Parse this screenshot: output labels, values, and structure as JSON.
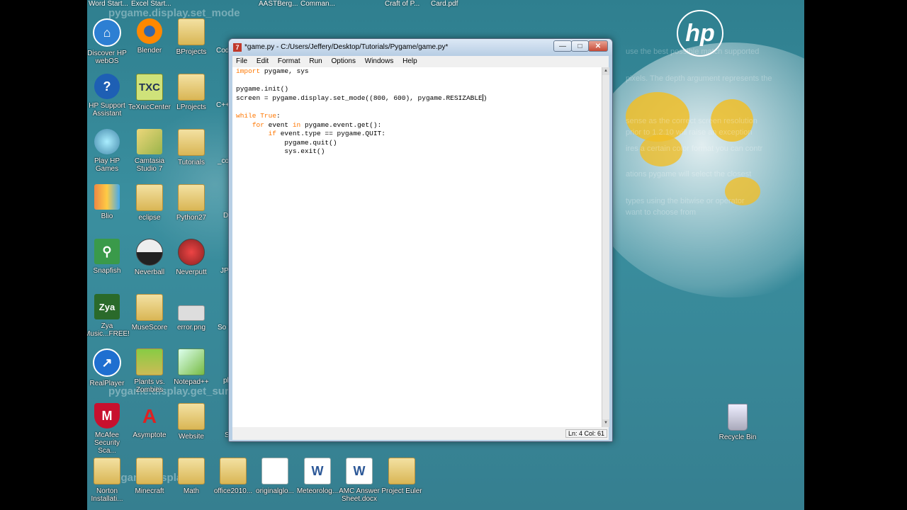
{
  "top_labels": [
    "Word Start...",
    "Excel Start...",
    "AASTBerg...",
    "Comman...",
    "Craft of P...",
    "Card.pdf"
  ],
  "background_ghosts": {
    "heading_1": "pygame.display.set_mode",
    "heading_2": "pygame.display.get_surface",
    "heading_3": "pygame.display.",
    "text_1": "use the best possible match supported",
    "text_2": "pixels. The depth argument represents the",
    "text_3": "sense as the correct screen resolution",
    "text_4": "prior to 1.2.10 will raise an exception",
    "text_5": "ires a certain color format you can contr",
    "text_6": "ations pygame will select the closest",
    "text_7": "types using the bitwise or operator",
    "text_8": "want to choose from"
  },
  "icons": [
    {
      "label": "Discover HP webOS",
      "kind": "hp"
    },
    {
      "label": "Blender",
      "kind": "blender"
    },
    {
      "label": "BProjects",
      "kind": "folder"
    },
    {
      "label": "HP Support Assistant",
      "kind": "help"
    },
    {
      "label": "TeXnicCenter",
      "kind": "txc"
    },
    {
      "label": "LProjects",
      "kind": "folder"
    },
    {
      "label": "Play HP Games",
      "kind": "games"
    },
    {
      "label": "Camtasia Studio 7",
      "kind": "camtasia"
    },
    {
      "label": "Tutorials",
      "kind": "folder"
    },
    {
      "label": "Blio",
      "kind": "blio"
    },
    {
      "label": "eclipse",
      "kind": "folder"
    },
    {
      "label": "Python27",
      "kind": "folder"
    },
    {
      "label": "Snapfish",
      "kind": "snapfish"
    },
    {
      "label": "Neverball",
      "kind": "neverball"
    },
    {
      "label": "Neverputt",
      "kind": "neverputt"
    },
    {
      "label": "Zya Music...FREE!",
      "kind": "zya"
    },
    {
      "label": "MuseScore",
      "kind": "folder"
    },
    {
      "label": "error.png",
      "kind": "image"
    },
    {
      "label": "RealPlayer",
      "kind": "realplayer"
    },
    {
      "label": "Plants vs. Zombies",
      "kind": "pvz"
    },
    {
      "label": "Notepad++",
      "kind": "notepad"
    },
    {
      "label": "McAfee Security Sca...",
      "kind": "mcafee"
    },
    {
      "label": "Asymptote",
      "kind": "asymptote"
    },
    {
      "label": "Website",
      "kind": "folder"
    },
    {
      "label": "Norton Installati...",
      "kind": "folder"
    },
    {
      "label": "Minecraft",
      "kind": "folder"
    },
    {
      "label": "Math",
      "kind": "folder"
    },
    {
      "label": "office2010...",
      "kind": "folder"
    },
    {
      "label": "originalglo...",
      "kind": "doc"
    },
    {
      "label": "Meteorolog...",
      "kind": "word"
    },
    {
      "label": "AMC Answer Sheet.docx",
      "kind": "word"
    },
    {
      "label": "Project Euler",
      "kind": "folder"
    },
    {
      "label": "Recycle Bin",
      "kind": "recycle"
    }
  ],
  "partial_labels": [
    "Cod",
    "C++",
    "_co",
    "D",
    "JP",
    "So Cor",
    "pl",
    "S"
  ],
  "brand": {
    "logo_text": "hp"
  },
  "window": {
    "title": "*game.py - C:/Users/Jeffery/Desktop/Tutorials/Pygame/game.py*",
    "min_symbol": "—",
    "max_symbol": "□",
    "close_symbol": "✕",
    "menu": [
      "File",
      "Edit",
      "Format",
      "Run",
      "Options",
      "Windows",
      "Help"
    ],
    "code": {
      "l1_kw": "import",
      "l1_rest": " pygame, sys",
      "l3": "pygame.init()",
      "l4": "screen = pygame.display.set_mode((800, 600), pygame.RESIZABLE",
      "l4_end": ")",
      "l6_kw": "while",
      "l6_true": " True",
      "l6_rest": ":",
      "l7_indent": "    ",
      "l7_kw": "for",
      "l7_mid": " event ",
      "l7_kw2": "in",
      "l7_rest": " pygame.event.get():",
      "l8_indent": "        ",
      "l8_kw": "if",
      "l8_rest": " event.type == pygame.QUIT:",
      "l9": "            pygame.quit()",
      "l10": "            sys.exit()"
    },
    "status": "Ln: 4  Col: 61",
    "scroll_up": "▲",
    "scroll_down": "▼"
  },
  "colors": {
    "keyword": "#ff7700",
    "desktop": "#3a8f9f"
  }
}
